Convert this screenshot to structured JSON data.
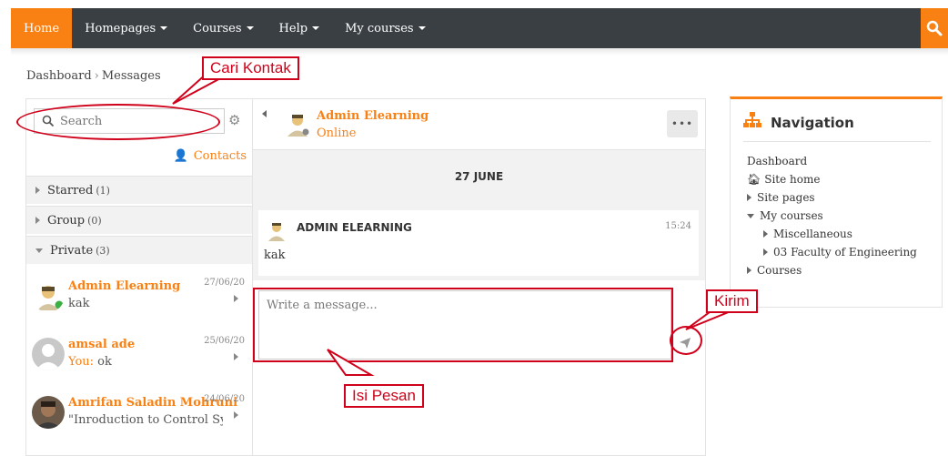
{
  "navbar": {
    "items": [
      {
        "label": "Home",
        "active": true,
        "caret": false
      },
      {
        "label": "Homepages",
        "active": false,
        "caret": true
      },
      {
        "label": "Courses",
        "active": false,
        "caret": true
      },
      {
        "label": "Help",
        "active": false,
        "caret": true
      },
      {
        "label": "My courses",
        "active": false,
        "caret": true
      }
    ],
    "search_icon": "search-icon"
  },
  "breadcrumb": {
    "root": "Dashboard",
    "current": "Messages"
  },
  "messages": {
    "search_placeholder": "Search",
    "contacts_label": "Contacts",
    "sections": [
      {
        "label": "Starred",
        "count": "(1)"
      },
      {
        "label": "Group",
        "count": "(0)"
      },
      {
        "label": "Private",
        "count": "(3)"
      }
    ],
    "conversations": [
      {
        "name": "Admin Elearning",
        "date": "27/06/20",
        "preview": "kak",
        "you_prefix": ""
      },
      {
        "name": "amsal ade",
        "date": "25/06/20",
        "preview": "ok",
        "you_prefix": "You:"
      },
      {
        "name": "Amrifan Saladin Mohruni",
        "date": "24/06/20",
        "preview": "\"Inroduction to Control Syste",
        "you_prefix": ""
      }
    ],
    "chat": {
      "contact_name": "Admin Elearning",
      "status": "Online",
      "more_label": "•••",
      "date_separator": "27 JUNE",
      "message": {
        "sender": "ADMIN ELEARNING",
        "time": "15:24",
        "text": "kak"
      },
      "composer_placeholder": "Write a message..."
    }
  },
  "navigation_block": {
    "title": "Navigation",
    "items": {
      "dashboard": "Dashboard",
      "site_home": "Site home",
      "site_pages": "Site pages",
      "my_courses": "My courses",
      "miscellaneous": "Miscellaneous",
      "faculty": "03 Faculty of Engineering",
      "courses": "Courses"
    }
  },
  "annotations": {
    "search_callout": "Cari Kontak",
    "send_callout": "Kirim",
    "message_callout": "Isi Pesan"
  },
  "colors": {
    "accent": "#f98012",
    "navbar": "#3a3f44",
    "annotation": "#d0021b"
  }
}
